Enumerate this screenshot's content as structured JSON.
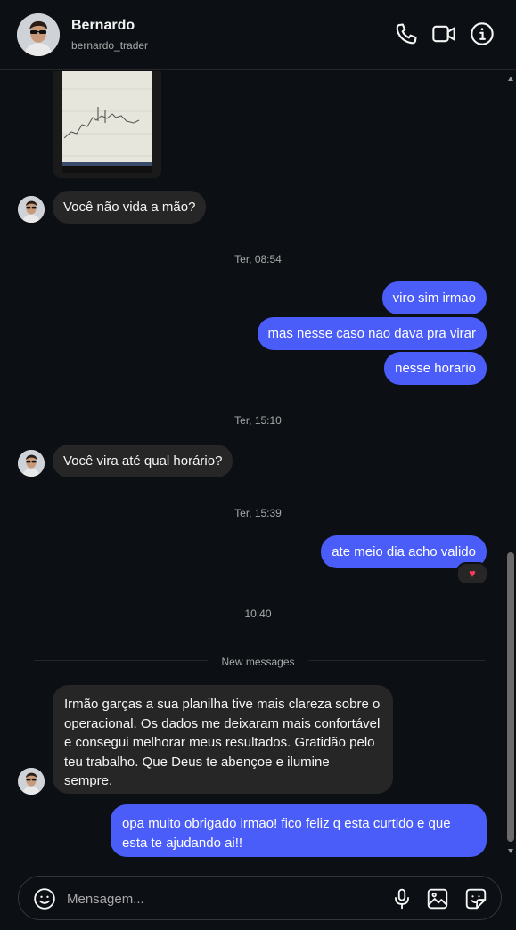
{
  "header": {
    "name": "Bernardo",
    "username": "bernardo_trader",
    "icons": [
      "phone-icon",
      "video-call-icon",
      "info-icon"
    ]
  },
  "messages": {
    "m1": "Você não vida a mão?",
    "ts1": "Ter, 08:54",
    "m2": "viro sim irmao",
    "m3": "mas nesse caso nao dava pra virar",
    "m4": "nesse horario",
    "ts2": "Ter, 15:10",
    "m5": "Você vira até qual horário?",
    "ts3": "Ter, 15:39",
    "m6": "ate meio dia acho valido",
    "reaction": "♥",
    "ts4": "10:40",
    "new_messages": "New messages",
    "m7": "Irmão garças a sua planilha tive mais clareza sobre o operacional. Os dados me deixaram mais confortável e consegui melhorar meus resultados. Gratidão pelo teu trabalho. Que Deus te abençoe e ilumine sempre.",
    "m8": "opa muito obrigado irmao! fico feliz q esta curtido e que esta te ajudando ai!!"
  },
  "composer": {
    "placeholder": "Mensagem...",
    "icons": [
      "emoji-icon",
      "microphone-icon",
      "image-icon",
      "sticker-icon"
    ]
  },
  "colors": {
    "background": "#0c1014",
    "incoming_bubble": "#262626",
    "outgoing_bubble": "#4a5df9",
    "reaction": "#ff3b5c"
  }
}
